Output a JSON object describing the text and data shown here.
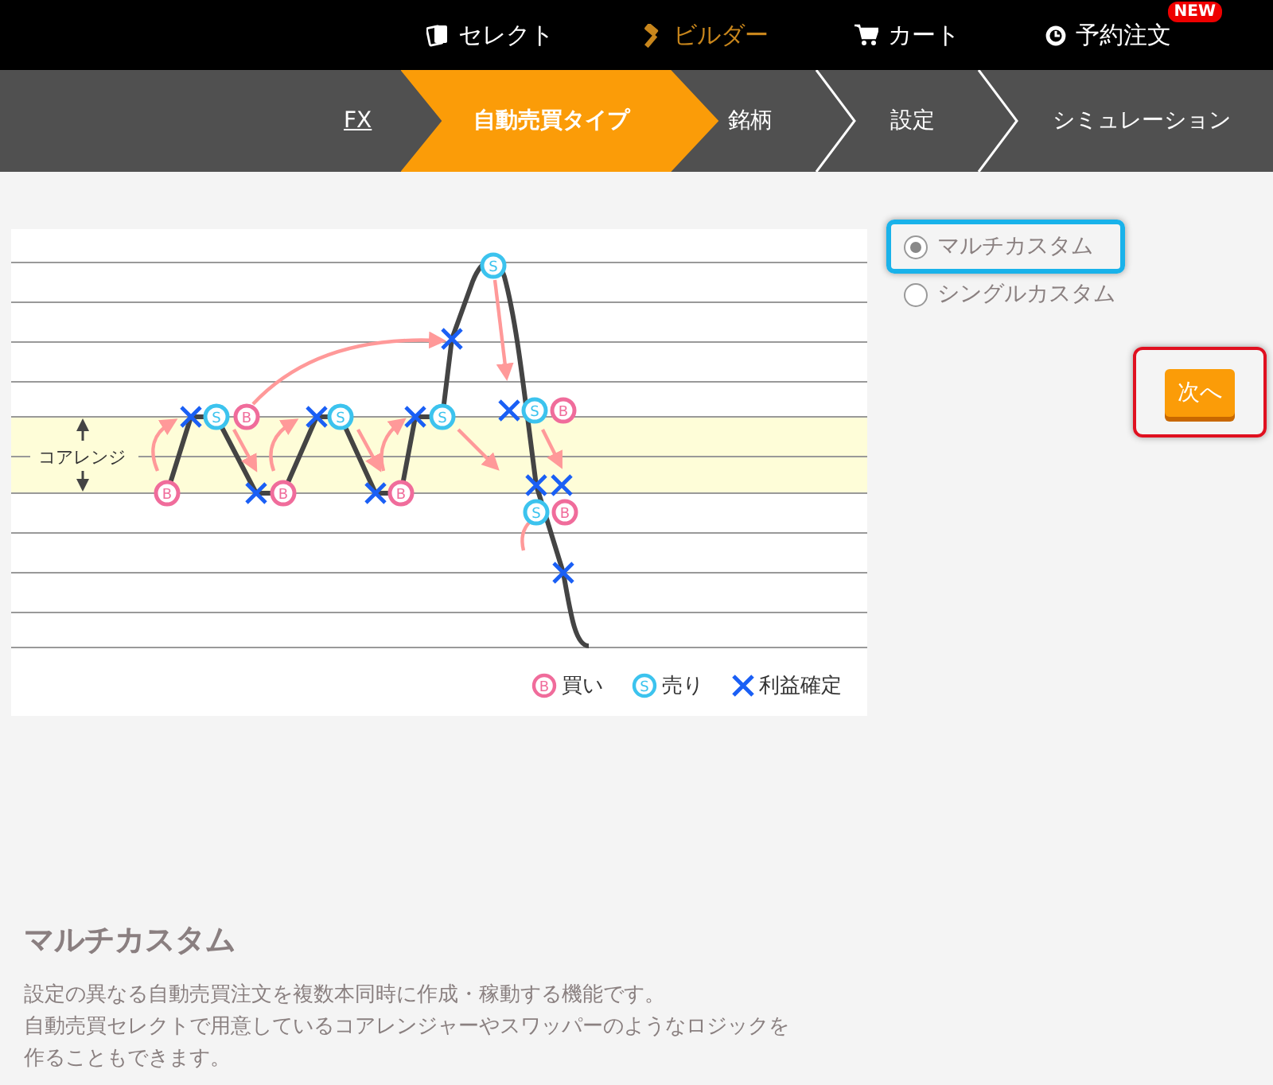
{
  "top_nav": [
    {
      "label": "セレクト",
      "selected": false
    },
    {
      "label": "ビルダー",
      "selected": true
    },
    {
      "label": "カート",
      "selected": false
    },
    {
      "label": "予約注文",
      "selected": false,
      "badge": "NEW"
    }
  ],
  "steps": [
    {
      "label": "FX",
      "kind": "link",
      "selected": false
    },
    {
      "label": "自動売買タイプ",
      "kind": "step",
      "selected": true
    },
    {
      "label": "銘柄",
      "kind": "step",
      "selected": false
    },
    {
      "label": "設定",
      "kind": "step",
      "selected": false
    },
    {
      "label": "シミュレーション",
      "kind": "step",
      "selected": false
    }
  ],
  "diagram": {
    "core_range_label": "コアレンジ",
    "markers": [
      {
        "kind": "sell",
        "mark": "S"
      },
      {
        "kind": "sell",
        "mark": "S"
      },
      {
        "kind": "sell",
        "mark": "S"
      },
      {
        "kind": "sell",
        "mark": "S"
      },
      {
        "kind": "sell",
        "mark": "S"
      },
      {
        "kind": "sell",
        "mark": "S"
      },
      {
        "kind": "buy",
        "mark": "B"
      },
      {
        "kind": "buy",
        "mark": "B"
      },
      {
        "kind": "buy",
        "mark": "B"
      },
      {
        "kind": "buy",
        "mark": "B"
      },
      {
        "kind": "buy",
        "mark": "B"
      },
      {
        "kind": "buy",
        "mark": "B"
      }
    ],
    "legend": [
      {
        "kind": "buy",
        "mark": "B",
        "label": "買い"
      },
      {
        "kind": "sell",
        "mark": "S",
        "label": "売り"
      },
      {
        "kind": "profit",
        "label": "利益確定"
      }
    ]
  },
  "options": [
    {
      "label": "マルチカスタム",
      "selected": true,
      "highlighted": true
    },
    {
      "label": "シングルカスタム",
      "selected": false,
      "highlighted": false
    }
  ],
  "next_button": {
    "label": "次へ",
    "highlighted": true
  },
  "description": {
    "title": "マルチカスタム",
    "lines": [
      "設定の異なる自動売買注文を複数本同時に作成・稼動する機能です。",
      "自動売買セレクトで用意しているコアレンジャーやスワッパーのようなロジックを",
      "作ることもできます。"
    ]
  }
}
